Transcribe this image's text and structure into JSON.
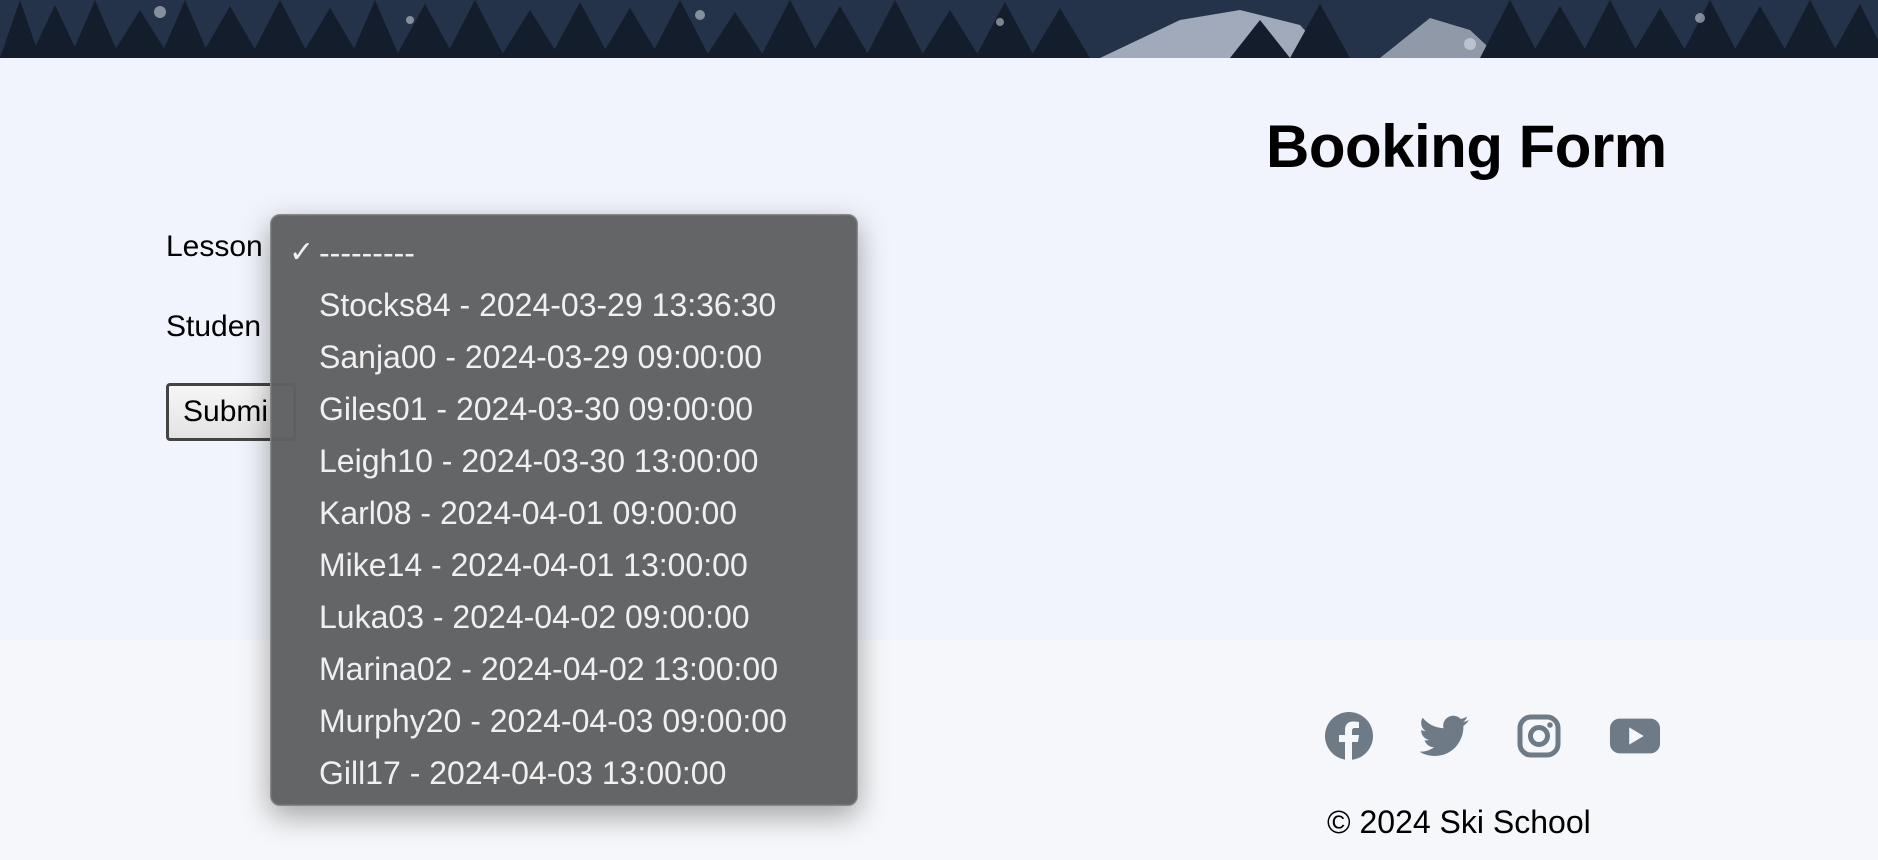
{
  "page": {
    "title": "Booking Form"
  },
  "form": {
    "lesson_label": "Lesson",
    "student_label": "Studen",
    "submit_label": "Submi"
  },
  "lesson_dropdown": {
    "selected_marker": "✓",
    "options": [
      "---------",
      "Stocks84 - 2024-03-29 13:36:30",
      "Sanja00 - 2024-03-29 09:00:00",
      "Giles01 - 2024-03-30 09:00:00",
      "Leigh10 - 2024-03-30 13:00:00",
      "Karl08 - 2024-04-01 09:00:00",
      "Mike14 - 2024-04-01 13:00:00",
      "Luka03 - 2024-04-02 09:00:00",
      "Marina02 - 2024-04-02 13:00:00",
      "Murphy20 - 2024-04-03 09:00:00",
      "Gill17 - 2024-04-03 13:00:00"
    ]
  },
  "footer": {
    "social_icons": [
      "facebook-icon",
      "twitter-icon",
      "instagram-icon",
      "youtube-icon"
    ],
    "icon_color": "#6f7a87",
    "copyright": "© 2024 Ski School"
  }
}
